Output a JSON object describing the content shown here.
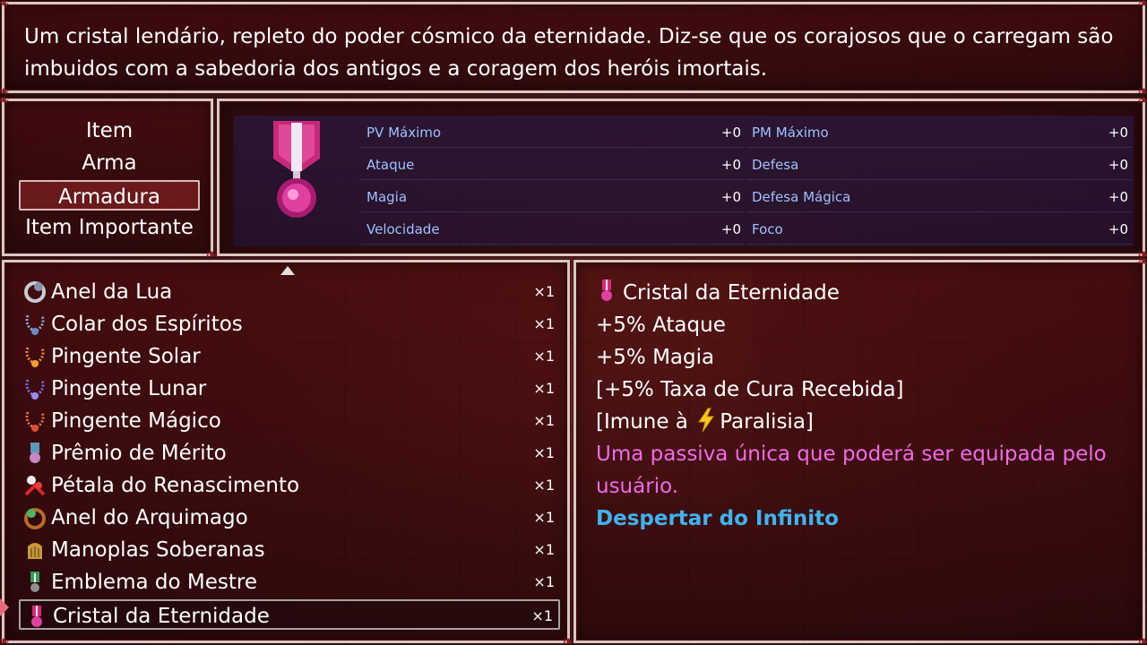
{
  "help": {
    "line1": "Um cristal lendário, repleto do poder cósmico da eternidade. Diz-se que os corajosos que o carregam são",
    "line2": "imbuidos com a sabedoria dos antigos e a coragem dos heróis imortais."
  },
  "categories": [
    {
      "label": "Item",
      "selected": false
    },
    {
      "label": "Arma",
      "selected": false
    },
    {
      "label": "Armadura",
      "selected": true
    },
    {
      "label": "Item Importante",
      "selected": false
    }
  ],
  "stats": [
    {
      "name": "PV Máximo",
      "value": "+0"
    },
    {
      "name": "PM Máximo",
      "value": "+0"
    },
    {
      "name": "Ataque",
      "value": "+0"
    },
    {
      "name": "Defesa",
      "value": "+0"
    },
    {
      "name": "Magia",
      "value": "+0"
    },
    {
      "name": "Defesa Mágica",
      "value": "+0"
    },
    {
      "name": "Velocidade",
      "value": "+0"
    },
    {
      "name": "Foco",
      "value": "+0"
    }
  ],
  "items": [
    {
      "name": "Anel da Lua",
      "qty": "×1",
      "icon": "moon-ring-icon"
    },
    {
      "name": "Colar dos Espíritos",
      "qty": "×1",
      "icon": "spirit-necklace-icon"
    },
    {
      "name": "Pingente Solar",
      "qty": "×1",
      "icon": "sun-pendant-icon"
    },
    {
      "name": "Pingente Lunar",
      "qty": "×1",
      "icon": "moon-pendant-icon"
    },
    {
      "name": "Pingente Mágico",
      "qty": "×1",
      "icon": "magic-pendant-icon"
    },
    {
      "name": "Prêmio de Mérito",
      "qty": "×1",
      "icon": "merit-medal-icon"
    },
    {
      "name": "Pétala do Renascimento",
      "qty": "×1",
      "icon": "rebirth-petal-icon"
    },
    {
      "name": "Anel do Arquimago",
      "qty": "×1",
      "icon": "archmage-ring-icon"
    },
    {
      "name": "Manoplas Soberanas",
      "qty": "×1",
      "icon": "gauntlets-icon"
    },
    {
      "name": "Emblema do Mestre",
      "qty": "×1",
      "icon": "master-emblem-icon"
    },
    {
      "name": "Cristal da Eternidade",
      "qty": "×1",
      "icon": "eternity-crystal-icon",
      "selected": true
    }
  ],
  "detail": {
    "title": "Cristal da Eternidade",
    "effect1": "+5% Ataque",
    "effect2": "+5% Magia",
    "effect3": "[+5% Taxa de Cura Recebida]",
    "immune_prefix": "[Imune à ",
    "immune_suffix": "Paralisia]",
    "passive_line1": "Uma passiva única que poderá ser equipada pelo",
    "passive_line2": "usuário.",
    "passive_name": "Despertar do Infinito"
  },
  "colors": {
    "stat_name": "#9ec2ff",
    "passive_text": "#f06ae8",
    "passive_name": "#3fb4f0"
  }
}
